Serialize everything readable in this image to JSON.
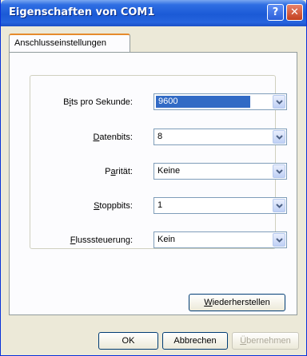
{
  "window": {
    "title": "Eigenschaften von COM1",
    "help_glyph": "?",
    "close_glyph": "✕"
  },
  "tab": {
    "label": "Anschlusseinstellungen"
  },
  "settings": {
    "bits_label_pre": "B",
    "bits_label_u": "i",
    "bits_label_post": "ts pro Sekunde:",
    "bits_value": "9600",
    "datenbits_label_u": "D",
    "datenbits_label_post": "atenbits:",
    "datenbits_value": "8",
    "paritaet_label_pre": "P",
    "paritaet_label_u": "a",
    "paritaet_label_post": "rität:",
    "paritaet_value": "Keine",
    "stoppbits_label_u": "S",
    "stoppbits_label_post": "toppbits:",
    "stoppbits_value": "1",
    "fluss_label_u": "F",
    "fluss_label_post": "lusssteuerung:",
    "fluss_value": "Kein"
  },
  "buttons": {
    "restore_u": "W",
    "restore_post": "iederherstellen",
    "ok": "OK",
    "cancel": "Abbrechen",
    "apply_u": "Ü",
    "apply_post": "bernehmen"
  }
}
